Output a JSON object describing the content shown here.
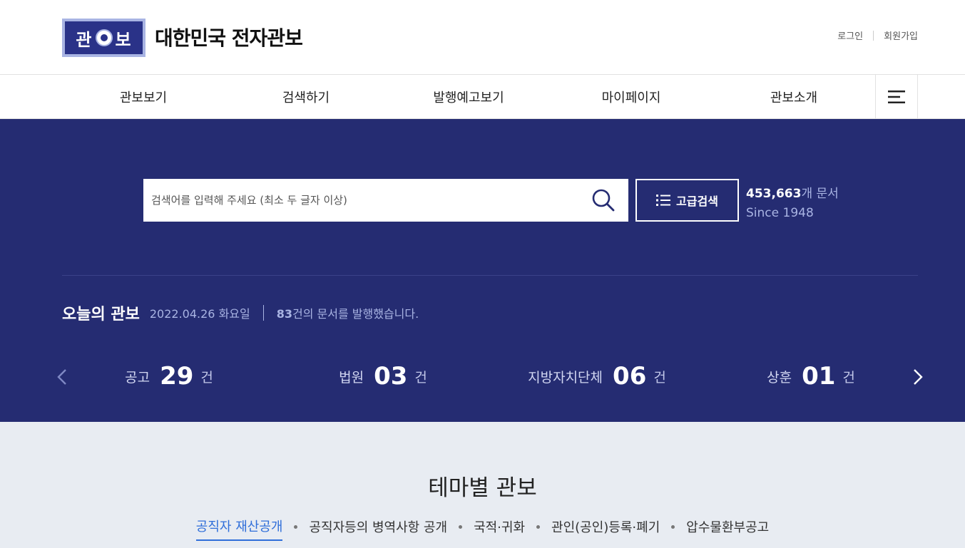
{
  "header": {
    "logo_text_left": "관",
    "logo_text_right": "보",
    "site_title": "대한민국 전자관보",
    "login": "로그인",
    "signup": "회원가입"
  },
  "nav": {
    "items": [
      "관보보기",
      "검색하기",
      "발행예고보기",
      "마이페이지",
      "관보소개"
    ],
    "menu_icon": "hamburger-icon"
  },
  "hero": {
    "search": {
      "placeholder": "검색어를 입력해 주세요 (최소 두 글자 이상)",
      "value": "",
      "icon": "search-icon"
    },
    "advanced_search_label": "고급검색",
    "doc_count": "453,663",
    "doc_unit": "개 문서",
    "since": "Since 1948",
    "today": {
      "title": "오늘의 관보",
      "date": "2022.04.26 화요일",
      "count": "83",
      "count_text": "건의 문서를 발행했습니다."
    },
    "stats": [
      {
        "label": "공고",
        "value": "29",
        "unit": "건"
      },
      {
        "label": "법원",
        "value": "03",
        "unit": "건"
      },
      {
        "label": "지방자치단체",
        "value": "06",
        "unit": "건"
      },
      {
        "label": "상훈",
        "value": "01",
        "unit": "건"
      }
    ]
  },
  "theme": {
    "title": "테마별 관보",
    "tabs": [
      "공직자 재산공개",
      "공직자등의 병역사항 공개",
      "국적·귀화",
      "관인(공인)등록·폐기",
      "압수물환부공고"
    ],
    "active_tab": "공직자 재산공개"
  },
  "colors": {
    "hero_bg": "#252c72",
    "accent_blue": "#2f6ed9",
    "theme_bg": "#e8ecf2"
  }
}
